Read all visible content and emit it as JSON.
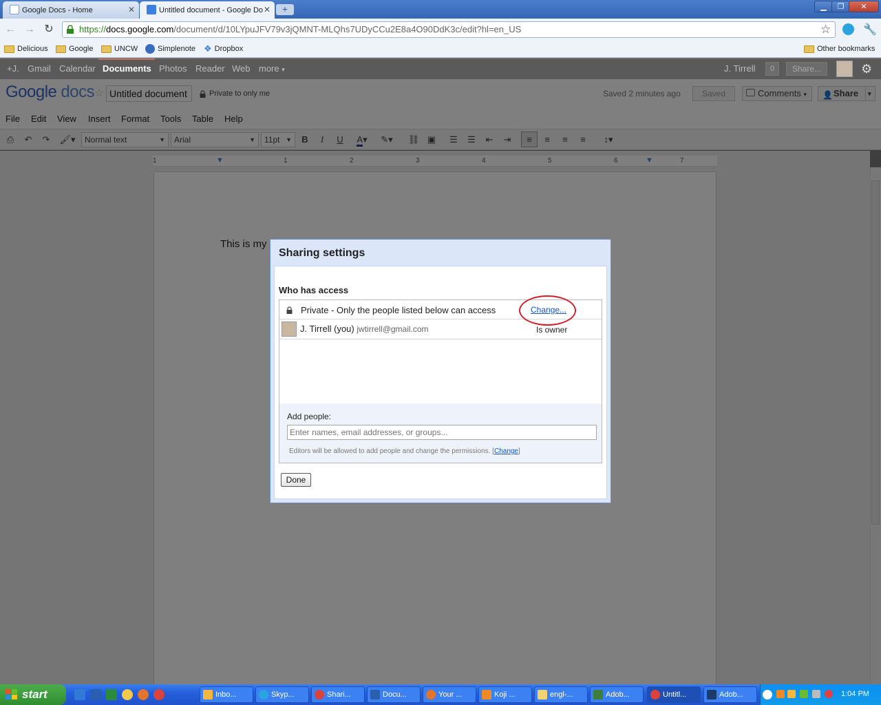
{
  "browser": {
    "tabs": [
      {
        "label": "Google Docs - Home"
      },
      {
        "label": "Untitled document - Google Do"
      }
    ],
    "url_scheme": "https://",
    "url_host": "docs.google.com",
    "url_path": "/document/d/10LYpuJFV79v3jQMNT-MLQhs7UDyCCu2E8a4O90DdK3c/edit?hl=en_US",
    "bookmarks": [
      "Delicious",
      "Google",
      "UNCW",
      "Simplenote",
      "Dropbox"
    ],
    "other_bookmarks": "Other bookmarks"
  },
  "gbar": {
    "items": [
      "+J.",
      "Gmail",
      "Calendar",
      "Documents",
      "Photos",
      "Reader",
      "Web",
      "more"
    ],
    "user": "J. Tirrell",
    "count": "0",
    "share": "Share..."
  },
  "docs": {
    "logo_google": "Google",
    "logo_docs": "docs",
    "title": "Untitled document",
    "privacy": "Private to only me",
    "saved_msg": "Saved 2 minutes ago",
    "saved_btn": "Saved",
    "comments_btn": "Comments",
    "share_btn": "Share",
    "menu": [
      "File",
      "Edit",
      "View",
      "Insert",
      "Format",
      "Tools",
      "Table",
      "Help"
    ],
    "style_select": "Normal text",
    "font_select": "Arial",
    "size_select": "11pt",
    "ruler_marks": [
      "1",
      "1",
      "2",
      "3",
      "4",
      "5",
      "6",
      "7"
    ],
    "body_text": "This is my"
  },
  "dialog": {
    "title": "Sharing settings",
    "who_has_access": "Who has access",
    "private_text": "Private - Only the people listed below can access",
    "change_link": "Change...",
    "user_name": "J. Tirrell (you)",
    "user_email": "jwtirrell@gmail.com",
    "user_role": "Is owner",
    "add_people_label": "Add people:",
    "add_people_placeholder": "Enter names, email addresses, or groups...",
    "editors_note": "Editors will be allowed to add people and change the permissions.",
    "editors_change": "Change",
    "done": "Done"
  },
  "taskbar": {
    "start": "start",
    "tasks": [
      "Inbo...",
      "Skyp...",
      "Shari...",
      "Docu...",
      "Your ...",
      "Koji ...",
      "engl-...",
      "Adob...",
      "Untitl...",
      "Adob..."
    ],
    "clock": "1:04 PM"
  },
  "colors": {
    "accent_blue": "#3565b5",
    "link_blue": "#1155cc",
    "highlight_circle": "#d2202a",
    "taskbar_blue": "#245edb",
    "start_green": "#2e8d2e"
  }
}
